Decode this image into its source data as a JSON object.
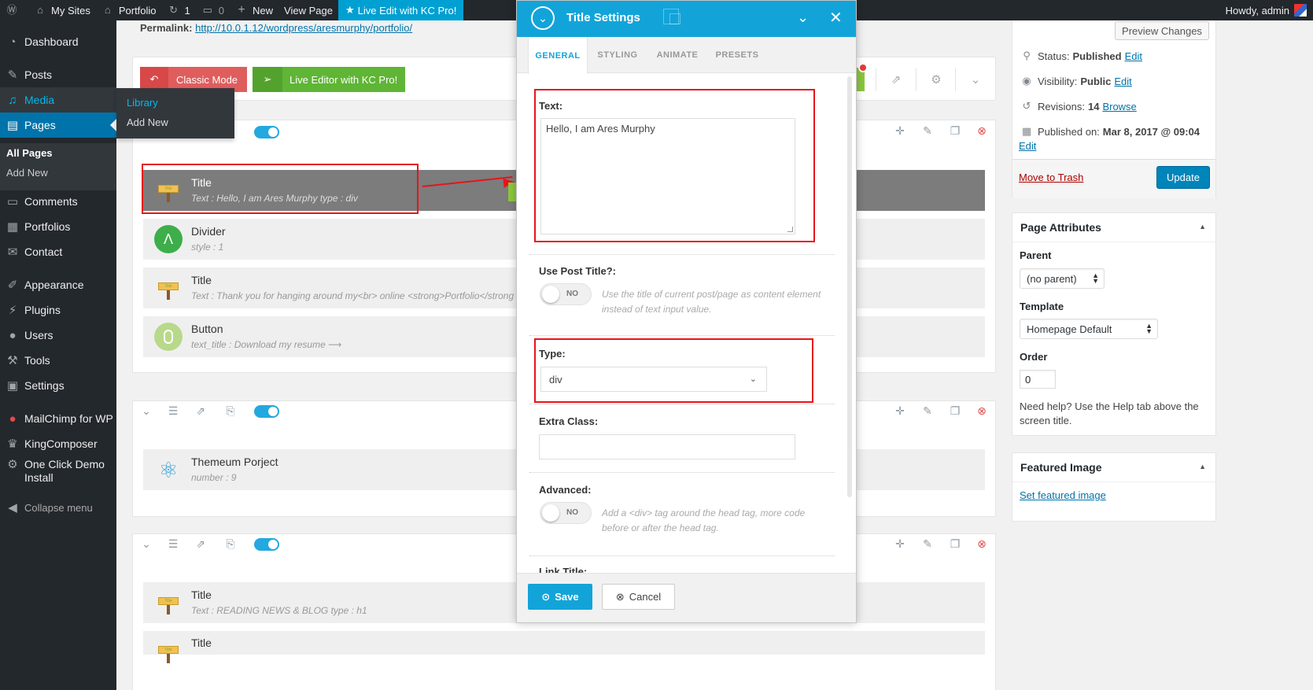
{
  "adminbar": {
    "my_sites": "My Sites",
    "site_name": "Portfolio",
    "updates_count": "1",
    "comments_count": "0",
    "new_label": "New",
    "view_page": "View Page",
    "kc_live": "Live Edit with KC Pro!",
    "howdy": "Howdy, admin"
  },
  "sidebar": {
    "items": [
      {
        "label": "Dashboard",
        "icon": "dashboard-icon"
      },
      {
        "label": "Posts",
        "icon": "pin-icon"
      },
      {
        "label": "Media",
        "icon": "media-icon"
      },
      {
        "label": "Pages",
        "icon": "pages-icon"
      },
      {
        "label": "Comments",
        "icon": "comment-icon"
      },
      {
        "label": "Portfolios",
        "icon": "portfolio-icon"
      },
      {
        "label": "Contact",
        "icon": "mail-icon"
      },
      {
        "label": "Appearance",
        "icon": "brush-icon"
      },
      {
        "label": "Plugins",
        "icon": "plug-icon"
      },
      {
        "label": "Users",
        "icon": "user-icon"
      },
      {
        "label": "Tools",
        "icon": "wrench-icon"
      },
      {
        "label": "Settings",
        "icon": "settings-icon"
      },
      {
        "label": "MailChimp for WP",
        "icon": "mailchimp-icon"
      },
      {
        "label": "KingComposer",
        "icon": "crown-icon"
      },
      {
        "label": "One Click Demo Install",
        "icon": "gear-icon"
      },
      {
        "label": "Collapse menu",
        "icon": "collapse-icon"
      }
    ],
    "pages_sub": [
      "All Pages",
      "Add New"
    ],
    "media_flyout": [
      "Library",
      "Add New"
    ]
  },
  "permalink": {
    "label": "Permalink:",
    "url": "http://10.0.1.12/wordpress/aresmurphy/portfolio/"
  },
  "editor": {
    "classic_mode": "Classic Mode",
    "live_editor": "Live Editor with KC Pro!"
  },
  "elements": [
    {
      "title": "Title",
      "desc": "Text : Hello, I am Ares Murphy  type : div"
    },
    {
      "title": "Divider",
      "desc": "style : 1"
    },
    {
      "title": "Title",
      "desc": "Text : Thank you for hanging around my<br> online <strong>Portfolio</strong>"
    },
    {
      "title": "Button",
      "desc": "text_title : Download my resume  ⟶"
    },
    {
      "title": "Themeum Porject",
      "desc": "number : 9"
    },
    {
      "title": "Title",
      "desc": "Text : READING NEWS & BLOG  type : h1"
    },
    {
      "title": "Title",
      "desc": ""
    }
  ],
  "publish": {
    "preview": "Preview Changes",
    "status_label": "Status:",
    "status_value": "Published",
    "visibility_label": "Visibility:",
    "visibility_value": "Public",
    "revisions_label": "Revisions:",
    "revisions_value": "14",
    "browse": "Browse",
    "published_label": "Published on:",
    "published_value": "Mar 8, 2017 @ 09:04",
    "edit": "Edit",
    "trash": "Move to Trash",
    "update": "Update"
  },
  "page_attributes": {
    "heading": "Page Attributes",
    "parent_label": "Parent",
    "parent_value": "(no parent)",
    "template_label": "Template",
    "template_value": "Homepage Default",
    "order_label": "Order",
    "order_value": "0",
    "help": "Need help? Use the Help tab above the screen title."
  },
  "featured": {
    "heading": "Featured Image",
    "link": "Set featured image"
  },
  "modal": {
    "title": "Title Settings",
    "tabs": [
      "GENERAL",
      "STYLING",
      "ANIMATE",
      "PRESETS"
    ],
    "text_label": "Text:",
    "text_value": "Hello, I am Ares Murphy",
    "post_title_label": "Use Post Title?:",
    "post_title_switch": "NO",
    "post_title_hint": "Use the title of current post/page as content element instead of text input value.",
    "type_label": "Type:",
    "type_value": "div",
    "extra_class_label": "Extra Class:",
    "advanced_label": "Advanced:",
    "advanced_switch": "NO",
    "advanced_hint": "Add a <div> tag around the head tag, more code before or after the head tag.",
    "link_title_label": "Link Title:",
    "save": "Save",
    "cancel": "Cancel"
  },
  "colors": {
    "accent": "#12a4d9",
    "wp_blue": "#0073aa",
    "annotation_red": "#e8131b"
  }
}
